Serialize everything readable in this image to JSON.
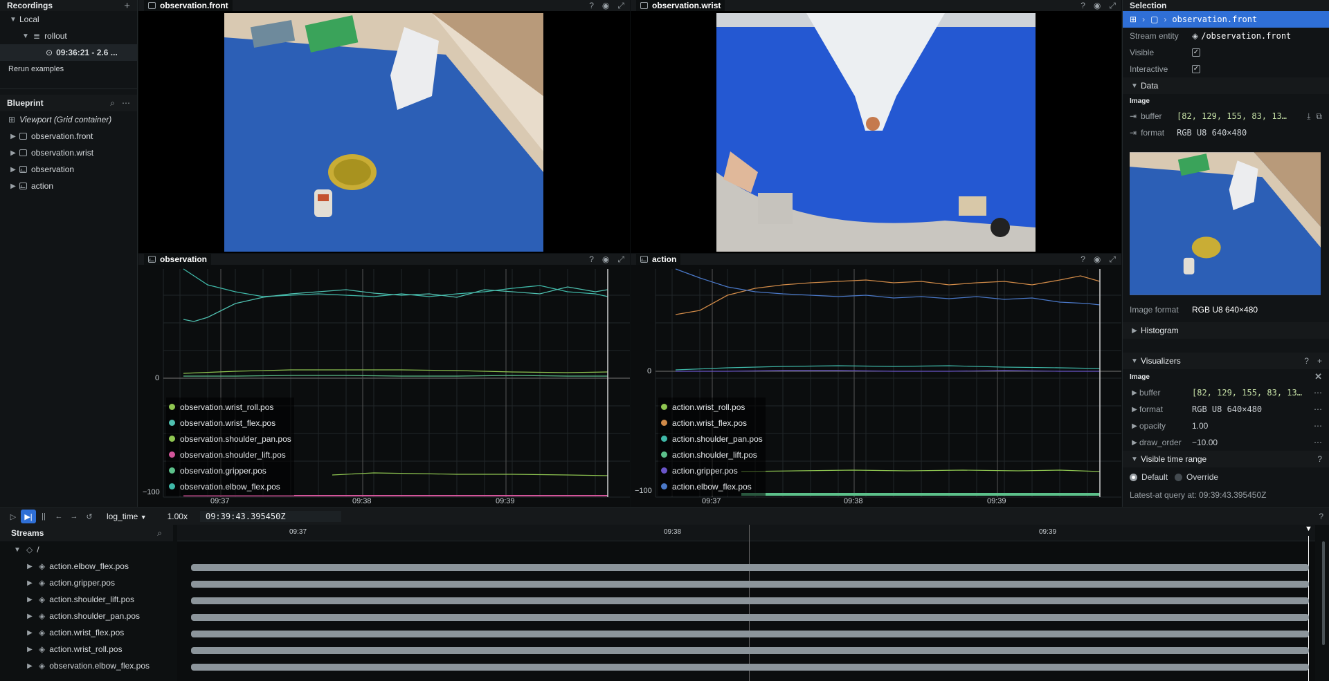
{
  "recordings": {
    "title": "Recordings",
    "add": "+",
    "local": "Local",
    "rollout": "rollout",
    "recording": "09:36:21 - 2.6 ...",
    "examples": "Rerun examples"
  },
  "blueprint": {
    "title": "Blueprint",
    "items": [
      {
        "label": "Viewport (Grid container)",
        "kind": "grid"
      },
      {
        "label": "observation.front",
        "kind": "image"
      },
      {
        "label": "observation.wrist",
        "kind": "image"
      },
      {
        "label": "observation",
        "kind": "chart"
      },
      {
        "label": "action",
        "kind": "chart"
      }
    ]
  },
  "views": {
    "front": {
      "title": "observation.front"
    },
    "wrist": {
      "title": "observation.wrist"
    },
    "obs": {
      "title": "observation",
      "y_zero": "0",
      "y_min": "−100",
      "ticks": [
        "09:37",
        "09:38",
        "09:39"
      ],
      "legend": [
        {
          "label": "observation.wrist_roll.pos",
          "color": "#8fc651"
        },
        {
          "label": "observation.wrist_flex.pos",
          "color": "#4fc0b0"
        },
        {
          "label": "observation.shoulder_pan.pos",
          "color": "#8fc651"
        },
        {
          "label": "observation.shoulder_lift.pos",
          "color": "#d2559a"
        },
        {
          "label": "observation.gripper.pos",
          "color": "#5cc08a"
        },
        {
          "label": "observation.elbow_flex.pos",
          "color": "#3fb8a8"
        }
      ]
    },
    "act": {
      "title": "action",
      "y_zero": "0",
      "y_min": "−100",
      "ticks": [
        "09:37",
        "09:38",
        "09:39"
      ],
      "legend": [
        {
          "label": "action.wrist_roll.pos",
          "color": "#8fc651"
        },
        {
          "label": "action.wrist_flex.pos",
          "color": "#d08a48"
        },
        {
          "label": "action.shoulder_pan.pos",
          "color": "#3fb8a8"
        },
        {
          "label": "action.shoulder_lift.pos",
          "color": "#5cc08a"
        },
        {
          "label": "action.gripper.pos",
          "color": "#6a55c8"
        },
        {
          "label": "action.elbow_flex.pos",
          "color": "#4a78c8"
        }
      ]
    }
  },
  "selection": {
    "title": "Selection",
    "path": "observation.front",
    "stream_entity_label": "Stream entity",
    "stream_entity": "/observation.front",
    "visible_label": "Visible",
    "interactive_label": "Interactive",
    "check": "✓",
    "data_label": "Data",
    "image_label": "Image",
    "buffer_label": "buffer",
    "buffer_value": "[82, 129, 155, 83, 13…",
    "format_label": "format",
    "format_value": "RGB U8 640×480",
    "image_format_label": "Image format",
    "image_format_value": "RGB U8 640×480",
    "histogram": "Histogram",
    "visualizers": "Visualizers",
    "vis_image": "Image",
    "vis_buffer": "[82, 129, 155, 83, 13…",
    "vis_format": "RGB U8 640×480",
    "opacity_label": "opacity",
    "opacity": "1.00",
    "draw_order_label": "draw_order",
    "draw_order": "−10.00",
    "visible_time_range": "Visible time range",
    "default": "Default",
    "override": "Override",
    "latest_at": "Latest-at query at: 09:39:43.395450Z"
  },
  "timeline": {
    "timeline": "log_time",
    "speed": "1.00x",
    "time": "09:39:43.395450Z",
    "ticks": [
      "09:37",
      "09:38",
      "09:39"
    ],
    "streams_title": "Streams",
    "root": "/",
    "streams": [
      "action.elbow_flex.pos",
      "action.gripper.pos",
      "action.shoulder_lift.pos",
      "action.shoulder_pan.pos",
      "action.wrist_flex.pos",
      "action.wrist_roll.pos",
      "observation.elbow_flex.pos"
    ]
  },
  "colors": {
    "accent": "#2f6fd6",
    "panel": "#111416",
    "header": "#16191b"
  }
}
